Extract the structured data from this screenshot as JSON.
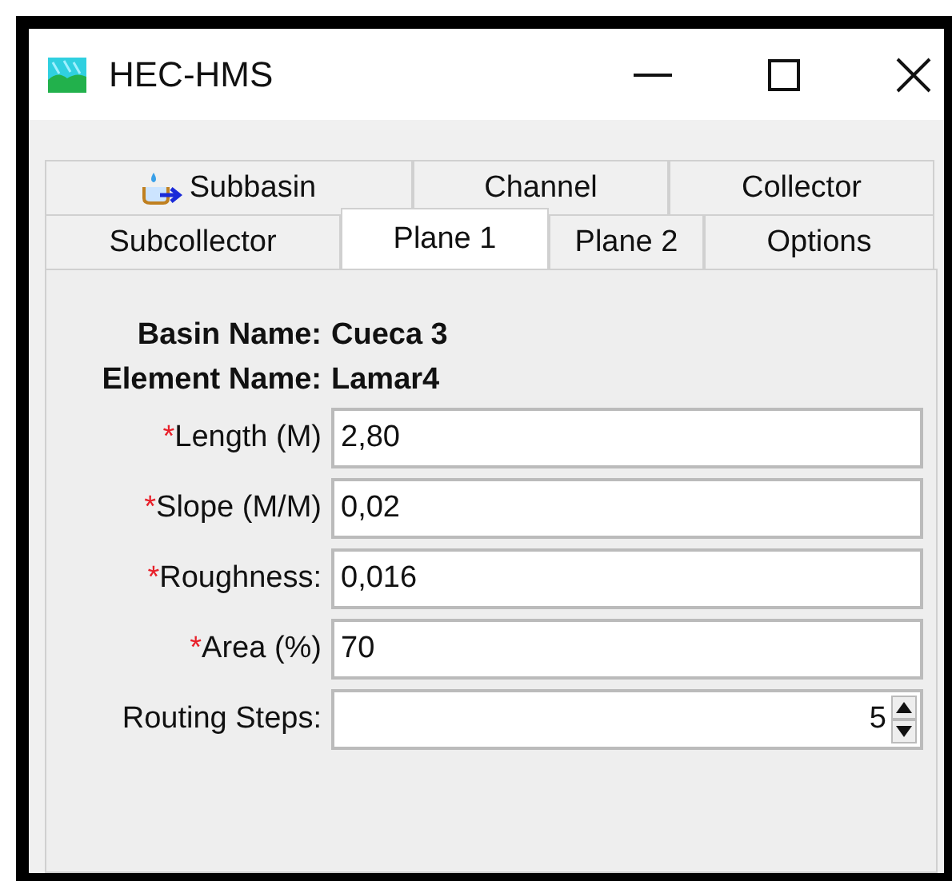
{
  "window": {
    "title": "HEC-HMS"
  },
  "tab_rows": [
    [
      {
        "label": "Subbasin",
        "icon": true,
        "selected": false
      },
      {
        "label": "Channel",
        "icon": false,
        "selected": false
      },
      {
        "label": "Collector",
        "icon": false,
        "selected": false
      }
    ],
    [
      {
        "label": "Subcollector",
        "icon": false,
        "selected": false
      },
      {
        "label": "Plane 1",
        "icon": false,
        "selected": true
      },
      {
        "label": "Plane 2",
        "icon": false,
        "selected": false
      },
      {
        "label": "Options",
        "icon": false,
        "selected": false
      }
    ]
  ],
  "info": [
    {
      "label": "Basin Name:",
      "value": "Cueca 3"
    },
    {
      "label": "Element Name:",
      "value": "Lamar4"
    }
  ],
  "fields": [
    {
      "kind": "text",
      "required_mark": "*",
      "label": "Length (M)",
      "value": "2,80"
    },
    {
      "kind": "text",
      "required_mark": "*",
      "label": "Slope (M/M)",
      "value": "0,02"
    },
    {
      "kind": "text",
      "required_mark": "*",
      "label": "Roughness:",
      "value": "0,016"
    },
    {
      "kind": "text",
      "required_mark": "*",
      "label": "Area (%)",
      "value": "70"
    },
    {
      "kind": "spinner",
      "label": "Routing Steps:",
      "value": "5"
    }
  ]
}
